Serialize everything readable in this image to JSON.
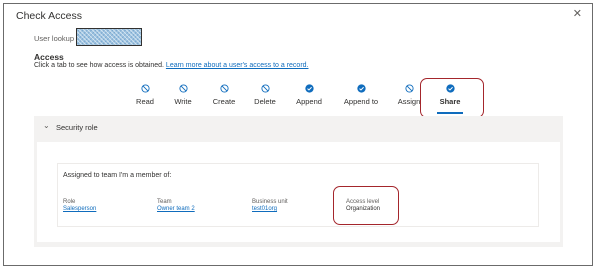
{
  "dialog": {
    "title": "Check Access",
    "close_icon": "close-icon"
  },
  "lookup": {
    "label": "User lookup",
    "value": ""
  },
  "access": {
    "heading": "Access",
    "description": "Click a tab to see how access is obtained.",
    "learn_more": "Learn more about a user's access to a record."
  },
  "tabs": [
    {
      "label": "Read",
      "icon": "no-access-icon",
      "granted": false
    },
    {
      "label": "Write",
      "icon": "no-access-icon",
      "granted": false
    },
    {
      "label": "Create",
      "icon": "no-access-icon",
      "granted": false
    },
    {
      "label": "Delete",
      "icon": "no-access-icon",
      "granted": false
    },
    {
      "label": "Append",
      "icon": "checkmark-icon",
      "granted": true
    },
    {
      "label": "Append to",
      "icon": "checkmark-icon",
      "granted": true
    },
    {
      "label": "Assign",
      "icon": "no-access-icon",
      "granted": false
    },
    {
      "label": "Share",
      "icon": "checkmark-icon",
      "granted": true,
      "selected": true
    }
  ],
  "section": {
    "title": "Security role",
    "assigned_text": "Assigned to team I'm a member of:",
    "columns": [
      {
        "header": "Role",
        "value": "Salesperson",
        "is_link": true
      },
      {
        "header": "Team",
        "value": "Owner team 2",
        "is_link": true
      },
      {
        "header": "Business unit",
        "value": "test01org",
        "is_link": true
      },
      {
        "header": "Access level",
        "value": "Organization",
        "is_link": false
      }
    ]
  },
  "colors": {
    "accent": "#0f6cbd",
    "highlight": "#a4262c",
    "panel": "#f3f2f1"
  }
}
